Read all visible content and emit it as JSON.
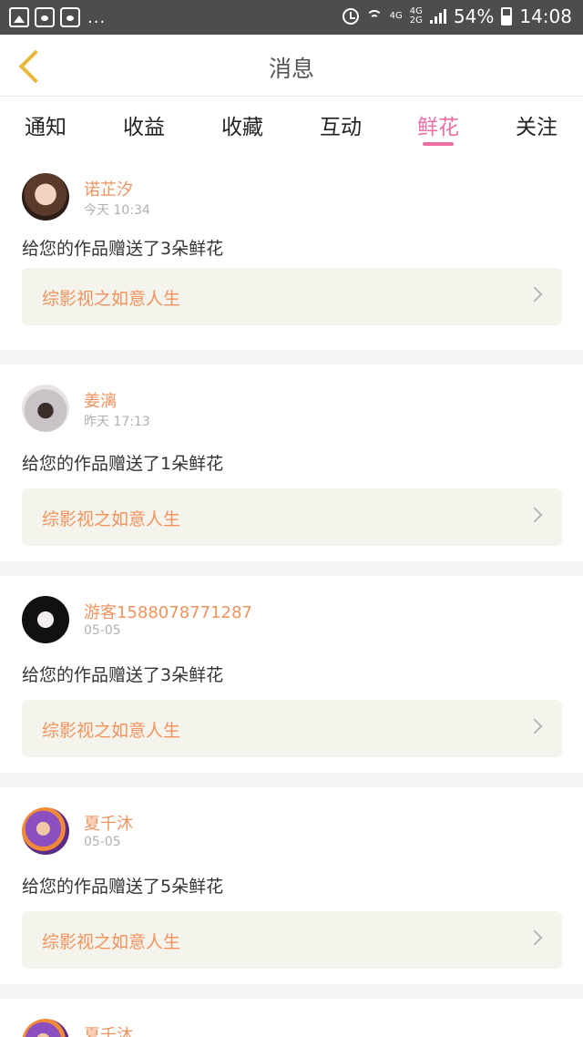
{
  "status_bar": {
    "dots": "...",
    "net_top": "4G",
    "net_top2": "4G",
    "net_bottom": "2G",
    "battery": "54%",
    "time": "14:08"
  },
  "header": {
    "title": "消息"
  },
  "tabs": [
    {
      "label": "通知"
    },
    {
      "label": "收益"
    },
    {
      "label": "收藏"
    },
    {
      "label": "互动"
    },
    {
      "label": "鲜花",
      "active": true
    },
    {
      "label": "关注"
    }
  ],
  "accent_colors": {
    "tab_active": "#ec6fa3",
    "username": "#f0935e",
    "back_arrow": "#e8b93a"
  },
  "messages": [
    {
      "user": "诺芷汐",
      "time": "今天 10:34",
      "text": "给您的作品赠送了3朵鲜花",
      "work": "综影视之如意人生"
    },
    {
      "user": "姜漓",
      "time": "昨天 17:13",
      "text": "给您的作品赠送了1朵鲜花",
      "work": "综影视之如意人生"
    },
    {
      "user": "游客1588078771287",
      "time": "05-05",
      "text": "给您的作品赠送了3朵鲜花",
      "work": "综影视之如意人生"
    },
    {
      "user": "夏千沐",
      "time": "05-05",
      "text": "给您的作品赠送了5朵鲜花",
      "work": "综影视之如意人生"
    },
    {
      "user": "夏千沐"
    }
  ]
}
